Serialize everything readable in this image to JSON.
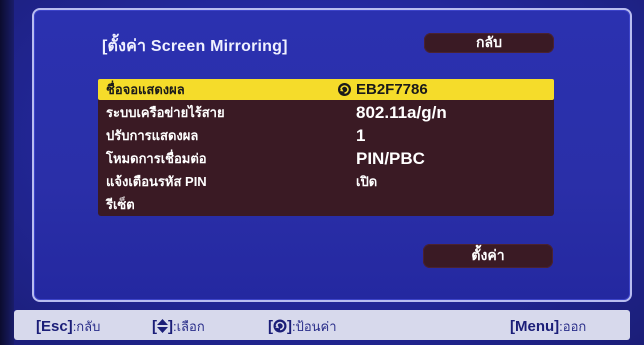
{
  "menu": {
    "title": "[ตั้งค่า Screen Mirroring]",
    "back_label": "กลับ",
    "set_label": "ตั้งค่า"
  },
  "settings": [
    {
      "label": "ชื่อจอแสดงผล",
      "value": "EB2F7786",
      "selected": true,
      "value_icon": "edit-enter-icon"
    },
    {
      "label": "ระบบเครือข่ายไร้สาย",
      "value": "802.11a/g/n"
    },
    {
      "label": "ปรับการแสดงผล",
      "value": "1"
    },
    {
      "label": "โหมดการเชื่อมต่อ",
      "value": "PIN/PBC"
    },
    {
      "label": "แจ้งเตือนรหัส PIN",
      "value": "เปิด"
    },
    {
      "label": "รีเซ็ต",
      "value": ""
    }
  ],
  "footer": {
    "esc_key": "[Esc]",
    "esc_text": ":กลับ",
    "select_key_open": "[",
    "select_key_close": "]",
    "select_text": ":เลือก",
    "enter_key_open": "[",
    "enter_key_close": "]",
    "enter_text": ":ป้อนค่า",
    "menu_key": "[Menu]",
    "menu_text": ":ออก"
  },
  "colors": {
    "background": "#2a2fa8",
    "highlight": "#f5dc2a",
    "button": "#3a1a24",
    "footer": "#d7d9ec"
  }
}
